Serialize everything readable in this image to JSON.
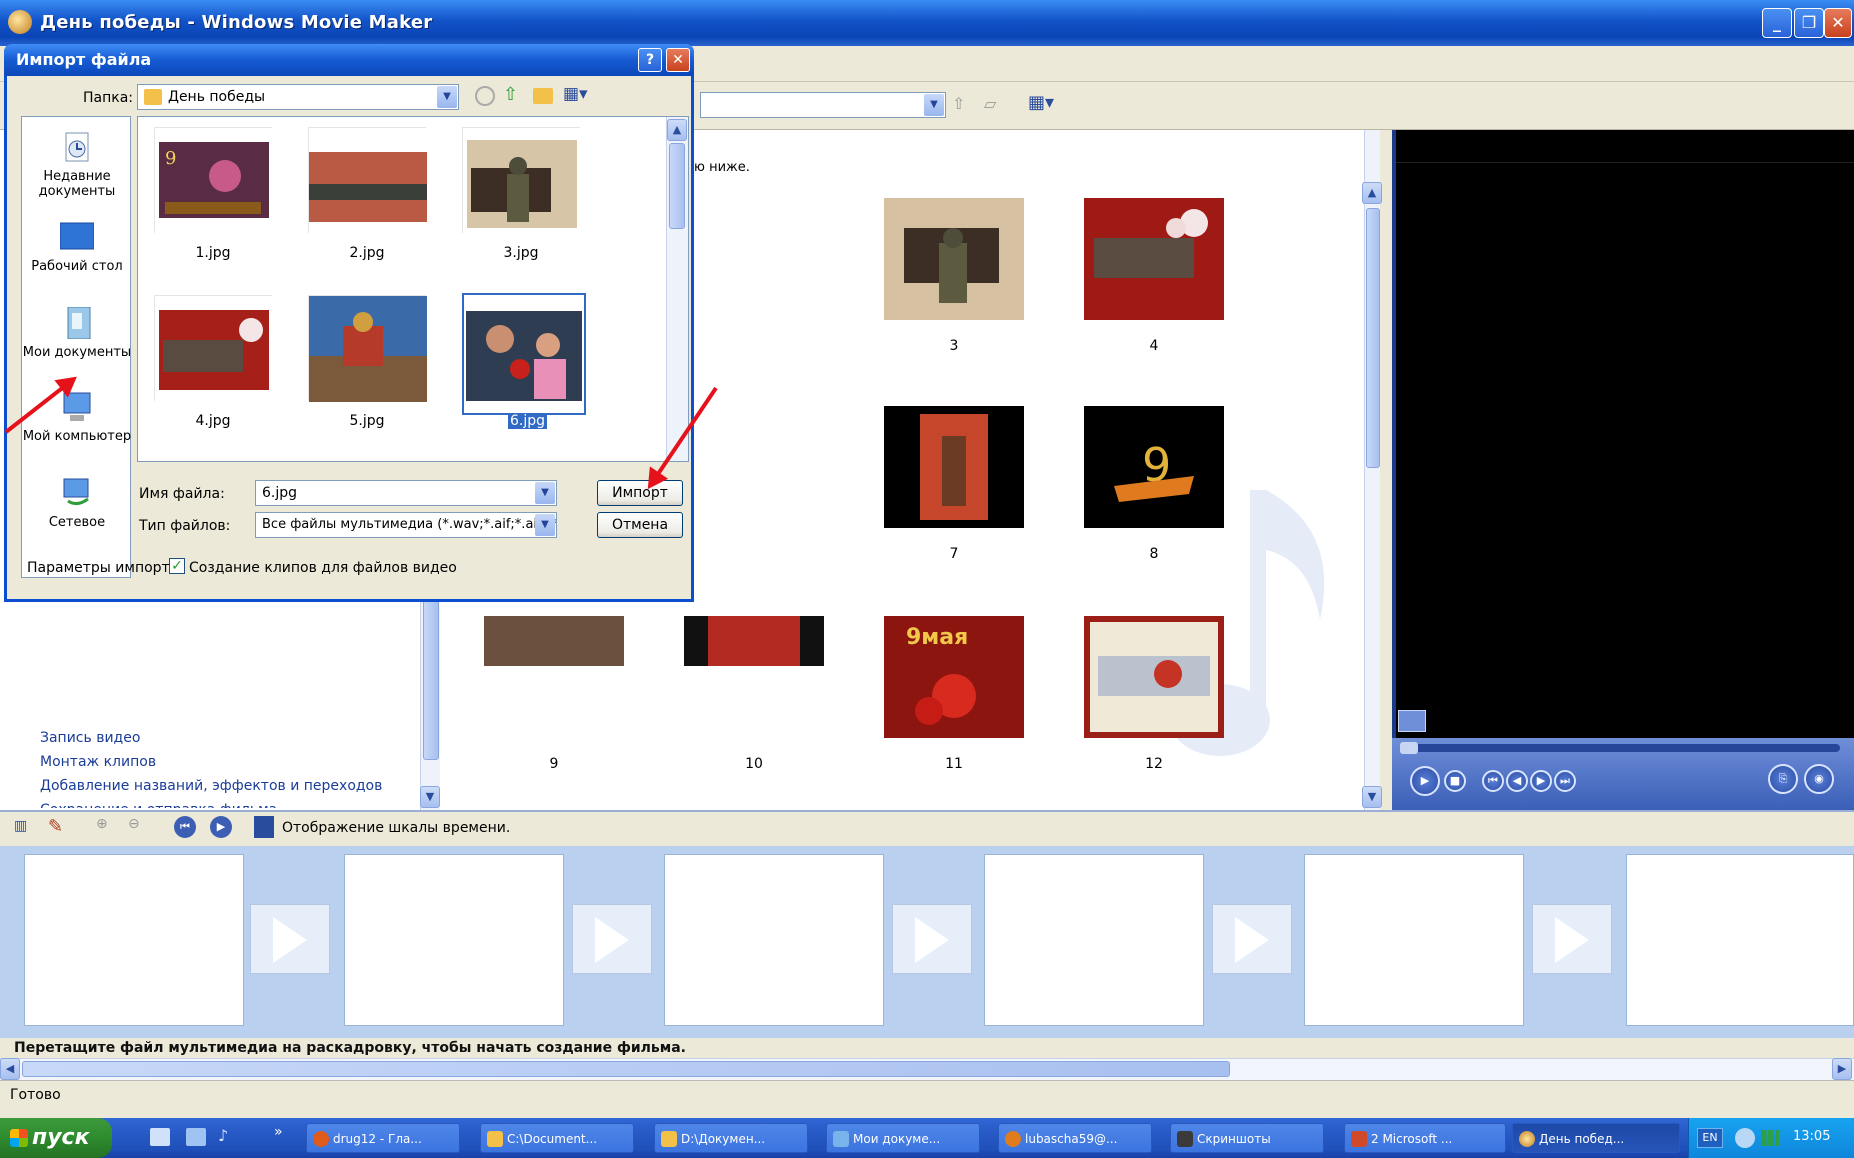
{
  "app": {
    "title": "День победы - Windows Movie Maker"
  },
  "content": {
    "hint": "ю ниже.",
    "clips": [
      {
        "label": "3"
      },
      {
        "label": "4"
      },
      {
        "label": "7"
      },
      {
        "label": "8"
      },
      {
        "label": "9"
      },
      {
        "label": "10"
      },
      {
        "label": "11"
      },
      {
        "label": "12"
      }
    ]
  },
  "tasks": {
    "links": [
      "Запись видео",
      "Монтаж клипов",
      "Добавление названий, эффектов и переходов",
      "Сохранение и отправка фильма"
    ]
  },
  "storyboard": {
    "toolbar_label": "Отображение шкалы времени.",
    "hint": "Перетащите файл мультимедиа на раскадровку, чтобы начать создание фильма."
  },
  "status": {
    "text": "Готово"
  },
  "dialog": {
    "title": "Импорт файла",
    "folder_label": "Папка:",
    "folder_value": "День победы",
    "places": [
      {
        "label": "Недавние документы",
        "icon": "recent-documents-icon"
      },
      {
        "label": "Рабочий стол",
        "icon": "desktop-icon"
      },
      {
        "label": "Мои документы",
        "icon": "my-documents-icon"
      },
      {
        "label": "Мой компьютер",
        "icon": "my-computer-icon"
      },
      {
        "label": "Сетевое",
        "icon": "network-icon"
      }
    ],
    "files": [
      "1.jpg",
      "2.jpg",
      "3.jpg",
      "4.jpg",
      "5.jpg",
      "6.jpg"
    ],
    "selected_file": "6.jpg",
    "filename_label": "Имя файла:",
    "filename_value": "6.jpg",
    "filetype_label": "Тип файлов:",
    "filetype_value": "Все файлы мультимедиа (*.wav;*.aif;*.aiff;*.a",
    "import_button": "Импорт",
    "cancel_button": "Отмена",
    "params_label": "Параметры импорта:",
    "create_clips_label": "Создание клипов для файлов видео",
    "create_clips_checked": true
  },
  "taskbar": {
    "start": "пуск",
    "buttons": [
      {
        "label": "drug12 - Гла..."
      },
      {
        "label": "C:\\Document..."
      },
      {
        "label": "D:\\Докумен..."
      },
      {
        "label": "Мои докуме..."
      },
      {
        "label": "lubascha59@..."
      },
      {
        "label": "Скриншоты"
      },
      {
        "label": "2 Microsoft ..."
      },
      {
        "label": "День побед..."
      }
    ],
    "lang": "EN",
    "clock": "13:05"
  },
  "colors": {
    "accent": "#0b4fd0",
    "arrow": "#e6121b",
    "storyboard_bg": "#b9d1ee"
  }
}
